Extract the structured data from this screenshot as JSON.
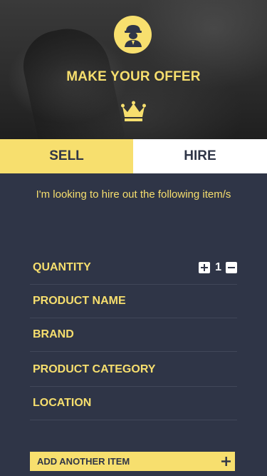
{
  "header": {
    "title": "MAKE YOUR OFFER",
    "avatar_icon": "worker-avatar-icon",
    "crown_icon": "crown-icon"
  },
  "tabs": [
    {
      "label": "SELL",
      "active": true
    },
    {
      "label": "HIRE",
      "active": false
    }
  ],
  "intro_text": "I'm looking to hire out the following item/s",
  "form": {
    "quantity_label": "QUANTITY",
    "quantity_value": "1",
    "product_name_label": "PRODUCT NAME",
    "brand_label": "BRAND",
    "product_category_label": "PRODUCT CATEGORY",
    "location_label": "LOCATION"
  },
  "add_item": {
    "label": "ADD ANOTHER ITEM",
    "icon": "plus-icon"
  },
  "colors": {
    "accent": "#f7df6e",
    "background": "#2f3547",
    "tab_inactive": "#ffffff"
  }
}
